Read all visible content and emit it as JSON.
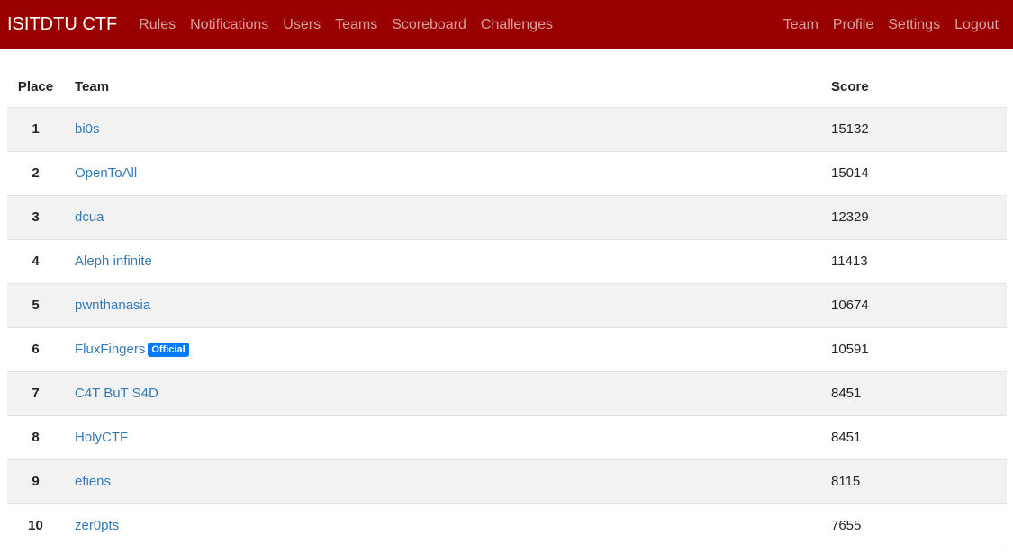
{
  "nav": {
    "brand": "ISITDTU CTF",
    "left_links": [
      "Rules",
      "Notifications",
      "Users",
      "Teams",
      "Scoreboard",
      "Challenges"
    ],
    "right_links": [
      "Team",
      "Profile",
      "Settings",
      "Logout"
    ]
  },
  "colors": {
    "navbar": "#990000",
    "link": "#337ab7",
    "badge": "#007bff"
  },
  "scoreboard": {
    "headers": {
      "place": "Place",
      "team": "Team",
      "score": "Score"
    },
    "rows": [
      {
        "place": "1",
        "team": "bi0s",
        "badge": "",
        "score": "15132"
      },
      {
        "place": "2",
        "team": "OpenToAll",
        "badge": "",
        "score": "15014"
      },
      {
        "place": "3",
        "team": "dcua",
        "badge": "",
        "score": "12329"
      },
      {
        "place": "4",
        "team": "Aleph infinite",
        "badge": "",
        "score": "11413"
      },
      {
        "place": "5",
        "team": "pwnthanasia",
        "badge": "",
        "score": "10674"
      },
      {
        "place": "6",
        "team": "FluxFingers",
        "badge": "Official",
        "score": "10591"
      },
      {
        "place": "7",
        "team": "C4T BuT S4D",
        "badge": "",
        "score": "8451"
      },
      {
        "place": "8",
        "team": "HolyCTF",
        "badge": "",
        "score": "8451"
      },
      {
        "place": "9",
        "team": "efiens",
        "badge": "",
        "score": "8115"
      },
      {
        "place": "10",
        "team": "zer0pts",
        "badge": "",
        "score": "7655"
      }
    ]
  }
}
